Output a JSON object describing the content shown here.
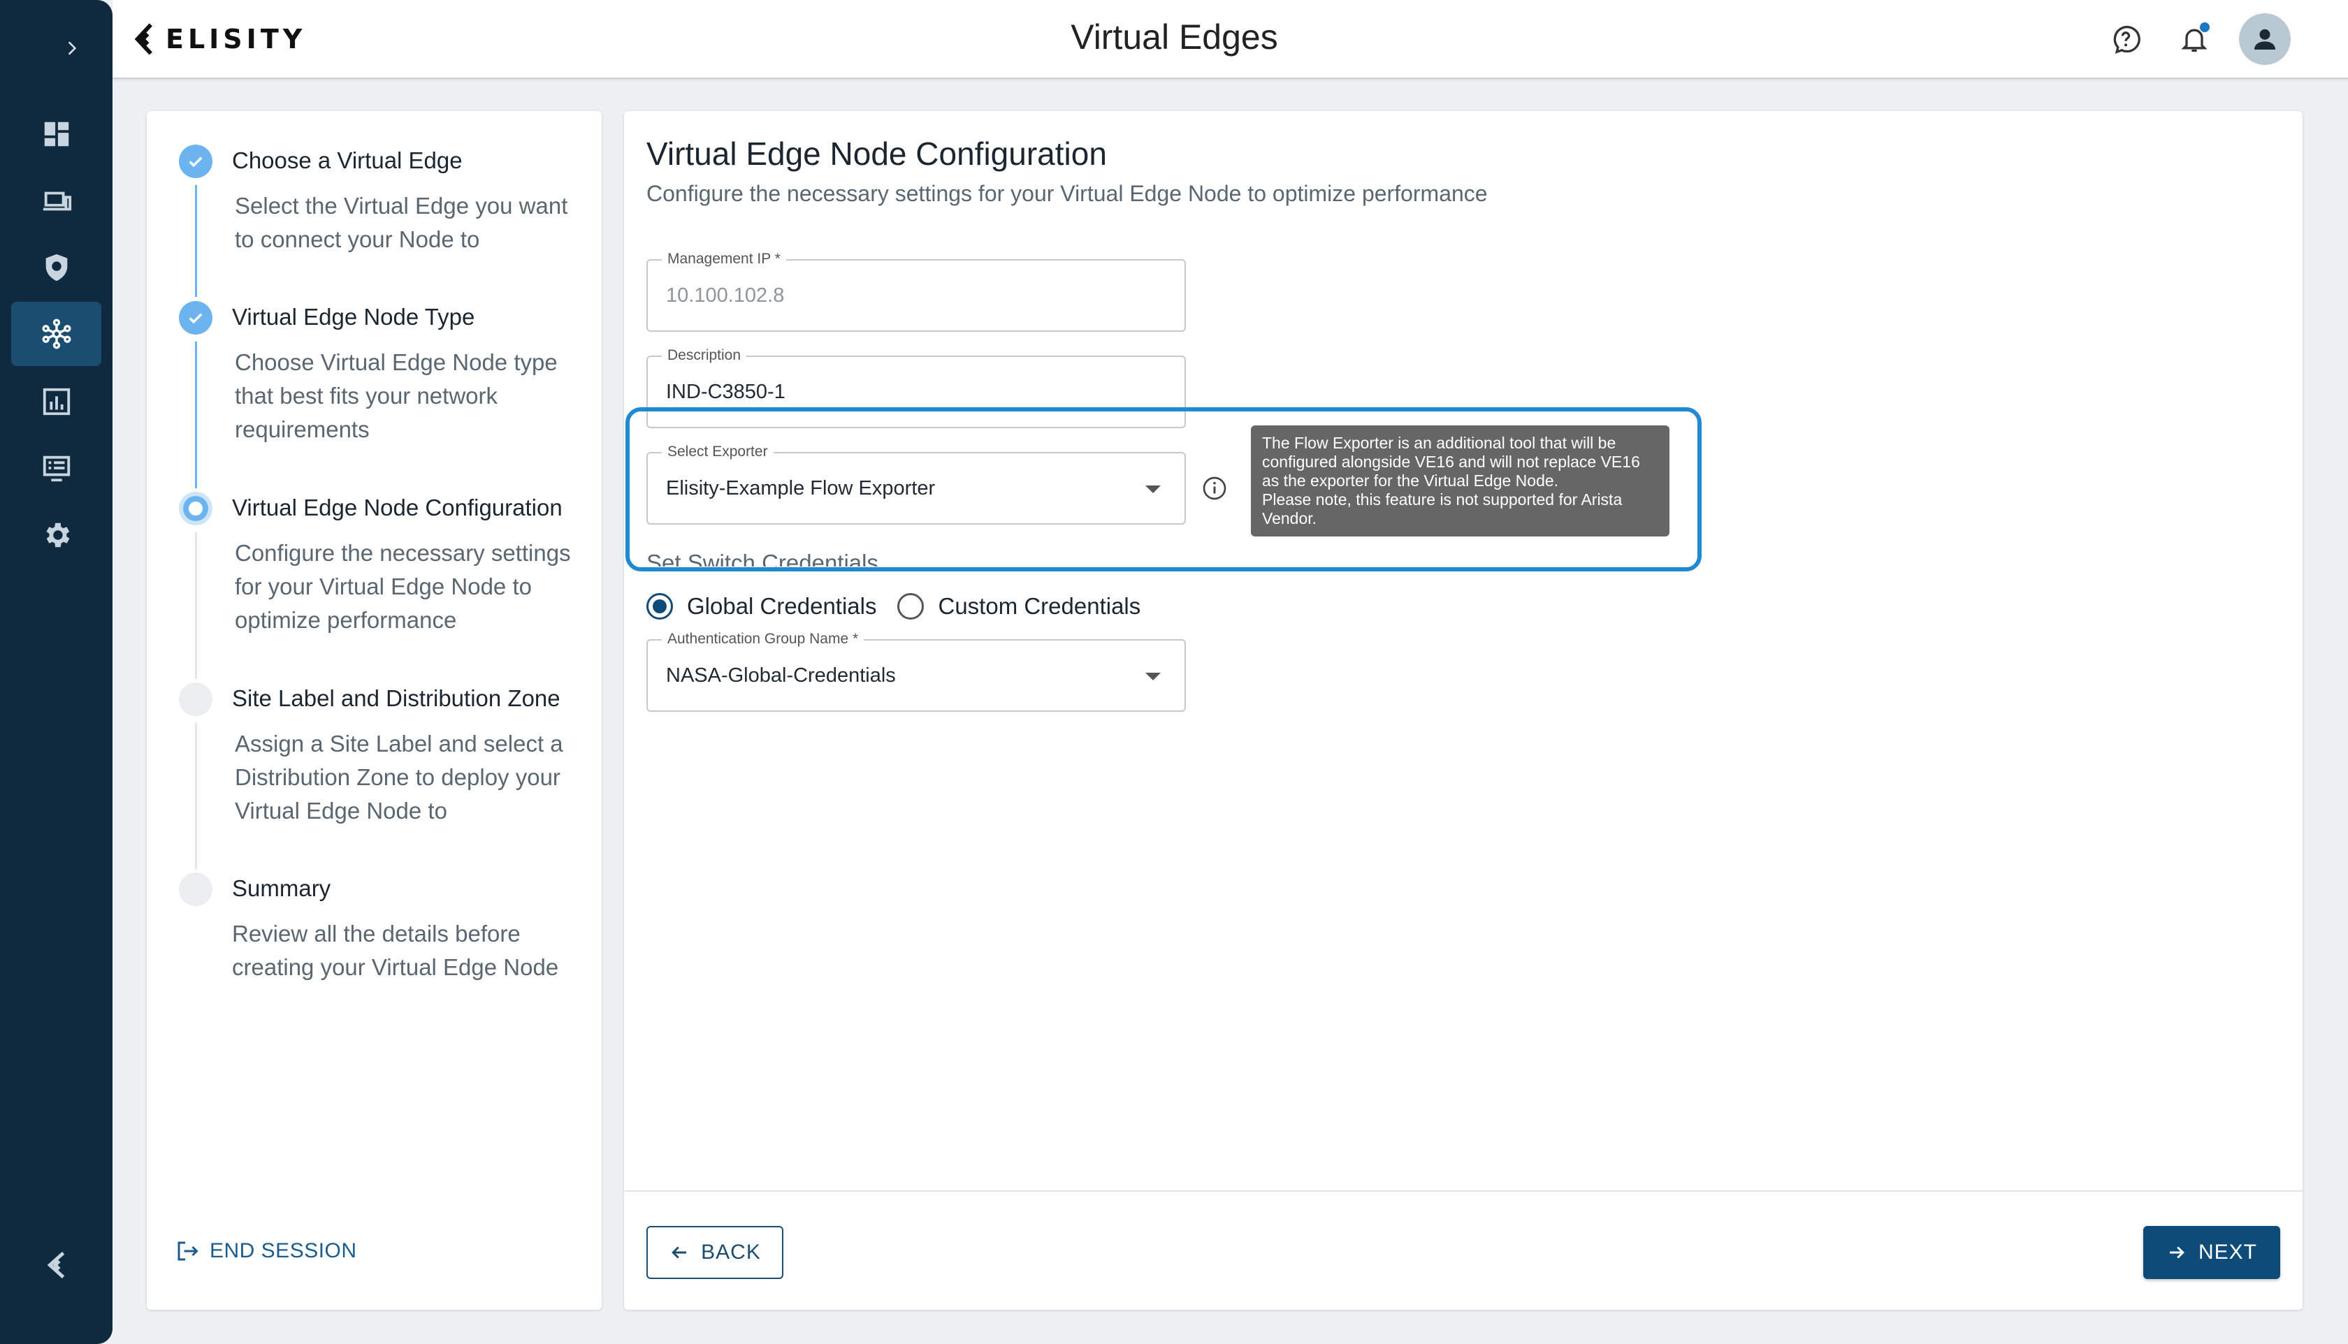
{
  "app": {
    "brand": "ELISITY",
    "page_title": "Virtual Edges"
  },
  "nav": {
    "items": [
      {
        "icon": "chevron-right-icon"
      },
      {
        "icon": "dashboard-icon"
      },
      {
        "icon": "devices-icon"
      },
      {
        "icon": "policy-shield-icon"
      },
      {
        "icon": "network-topology-icon",
        "active": true
      },
      {
        "icon": "analytics-icon"
      },
      {
        "icon": "logs-icon"
      },
      {
        "icon": "settings-icon"
      },
      {
        "icon": "elisity-logo-icon"
      }
    ]
  },
  "header": {
    "help_icon": "help-icon",
    "notification_icon": "bell-icon",
    "avatar_icon": "user-icon"
  },
  "stepper": {
    "steps": [
      {
        "title": "Choose a Virtual Edge",
        "desc": "Select the Virtual Edge you want to connect your Node to",
        "status": "done"
      },
      {
        "title": "Virtual Edge Node Type",
        "desc": "Choose Virtual Edge Node type that best fits your network requirements",
        "status": "done"
      },
      {
        "title": "Virtual Edge Node Configuration",
        "desc": "Configure the necessary settings for your Virtual Edge Node to optimize performance",
        "status": "current"
      },
      {
        "title": "Site Label and Distribution Zone",
        "desc": "Assign a Site Label and select a Distribution Zone to deploy your Virtual Edge Node to",
        "status": "todo"
      },
      {
        "title": "Summary",
        "desc": "Review all the details before creating your Virtual Edge Node",
        "status": "todo"
      }
    ],
    "end_session": "END SESSION"
  },
  "main": {
    "title": "Virtual Edge Node Configuration",
    "subtitle": "Configure the necessary settings for your Virtual Edge Node to optimize performance",
    "management_ip": {
      "label": "Management IP *",
      "value": "10.100.102.8"
    },
    "description": {
      "label": "Description",
      "value": "IND-C3850-1"
    },
    "exporter": {
      "label": "Select Exporter",
      "value": "Elisity-Example Flow Exporter"
    },
    "tooltip": "The Flow Exporter is an additional tool that will be configured alongside VE16 and will not replace VE16 as the exporter for the Virtual Edge Node.\nPlease note, this feature is not supported for Arista Vendor.",
    "section_label": "Set Switch Credentials",
    "credentials": {
      "global_label": "Global Credentials",
      "custom_label": "Custom Credentials",
      "selected": "global"
    },
    "auth_group": {
      "label": "Authentication Group Name *",
      "value": "NASA-Global-Credentials"
    },
    "back_label": "BACK",
    "next_label": "NEXT"
  },
  "colors": {
    "nav_bg": "#0f2a3f",
    "nav_active": "#1b4d70",
    "primary": "#0f4b78",
    "step_done": "#6cb4ef",
    "highlight": "#1f8ad2"
  }
}
